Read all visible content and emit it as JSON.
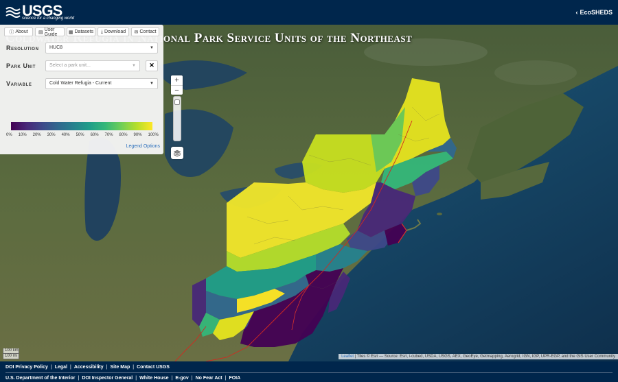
{
  "header": {
    "logo_text": "USGS",
    "logo_tagline": "science for a changing world",
    "eco_link": "EcoSHEDS"
  },
  "app_title": "Coldwater Refugia in National Park Service Units of the Northeast",
  "tabs": [
    {
      "label": "About",
      "icon": "info-icon"
    },
    {
      "label": "User Guide",
      "icon": "book-icon"
    },
    {
      "label": "Datasets",
      "icon": "table-icon"
    },
    {
      "label": "Download",
      "icon": "download-icon"
    },
    {
      "label": "Contact",
      "icon": "envelope-icon"
    }
  ],
  "controls": {
    "resolution_label": "Resolution",
    "resolution_value": "HUC8",
    "park_label": "Park Unit",
    "park_placeholder": "Select a park unit...",
    "variable_label": "Variable",
    "variable_value": "Cold Water Refugia - Current"
  },
  "legend": {
    "ticks": [
      "0%",
      "10%",
      "20%",
      "30%",
      "40%",
      "50%",
      "60%",
      "70%",
      "80%",
      "90%",
      "100%"
    ],
    "options_link": "Legend Options",
    "colors": [
      "#440154",
      "#482878",
      "#3e4989",
      "#31688e",
      "#26828e",
      "#1f9e89",
      "#35b779",
      "#6ece58",
      "#b5de2b",
      "#fde725"
    ]
  },
  "map_controls": {
    "zoom_in": "+",
    "zoom_out": "−"
  },
  "scale": {
    "km": "100 km",
    "mi": "100 mi"
  },
  "attribution": {
    "leaflet": "Leaflet",
    "text": "| Tiles © Esri — Source: Esri, i-cubed, USDA, USGS, AEX, GeoEye, Getmapping, Aerogrid, IGN, IGP, UPR-EGP, and the GIS User Community"
  },
  "footer": {
    "row1": [
      "DOI Privacy Policy",
      "Legal",
      "Accessibility",
      "Site Map",
      "Contact USGS"
    ],
    "row2": [
      "U.S. Department of the Interior",
      "DOI Inspector General",
      "White House",
      "E-gov",
      "No Fear Act",
      "FOIA"
    ]
  }
}
